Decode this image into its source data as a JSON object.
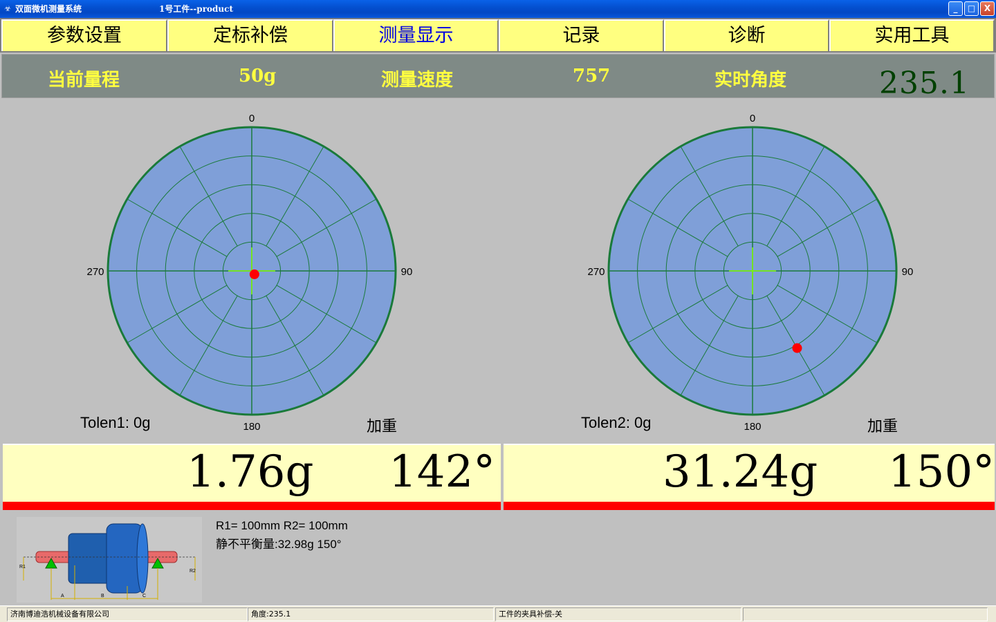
{
  "window": {
    "title": "双面微机测量系统",
    "subtitle": "1号工件--product",
    "icon": "app-icon",
    "buttons": {
      "minimize": "_",
      "maximize": "□",
      "close": "X"
    }
  },
  "menu": {
    "items": [
      {
        "label": "参数设置"
      },
      {
        "label": "定标补偿"
      },
      {
        "label": "测量显示"
      },
      {
        "label": "记录"
      },
      {
        "label": "诊断"
      },
      {
        "label": "实用工具"
      }
    ],
    "active_index": 2
  },
  "info": {
    "range_label": "当前量程",
    "range_value": "50g",
    "speed_label": "测量速度",
    "speed_value": "757",
    "angle_label": "实时角度",
    "angle_value": "235.1"
  },
  "polars": [
    {
      "labels": {
        "top": "0",
        "right": "90",
        "bottom": "180",
        "left": "270"
      },
      "tolerance": "Tolen1: 0g",
      "mode": "加重",
      "point": {
        "radius_fraction": 0.03,
        "angle_deg": 142
      },
      "result_mass": "1.76g",
      "result_angle": "142°"
    },
    {
      "labels": {
        "top": "0",
        "right": "90",
        "bottom": "180",
        "left": "270"
      },
      "tolerance": "Tolen2: 0g",
      "mode": "加重",
      "point": {
        "radius_fraction": 0.62,
        "angle_deg": 150
      },
      "result_mass": "31.24g",
      "result_angle": "150°"
    }
  ],
  "rotor_info": {
    "radii": "R1= 100mm   R2= 100mm",
    "static_unbalance": "静不平衡量:32.98g  150°",
    "diagram_labels": {
      "r1": "R1",
      "r2": "R2",
      "a": "A",
      "b": "B",
      "c": "C"
    }
  },
  "status": {
    "company": "济南博迪浩机械设备有限公司",
    "angle": "角度:235.1",
    "fixture": "工件的夹具补偿-关",
    "extra": ""
  },
  "colors": {
    "menu_bg": "#ffff80",
    "polar_fill": "#7f9fd8",
    "polar_grid": "#1a7a3a",
    "point": "#ff0000",
    "crosshair": "#80ff00",
    "result_bg": "#ffffc0",
    "info_text": "#ffff40"
  }
}
